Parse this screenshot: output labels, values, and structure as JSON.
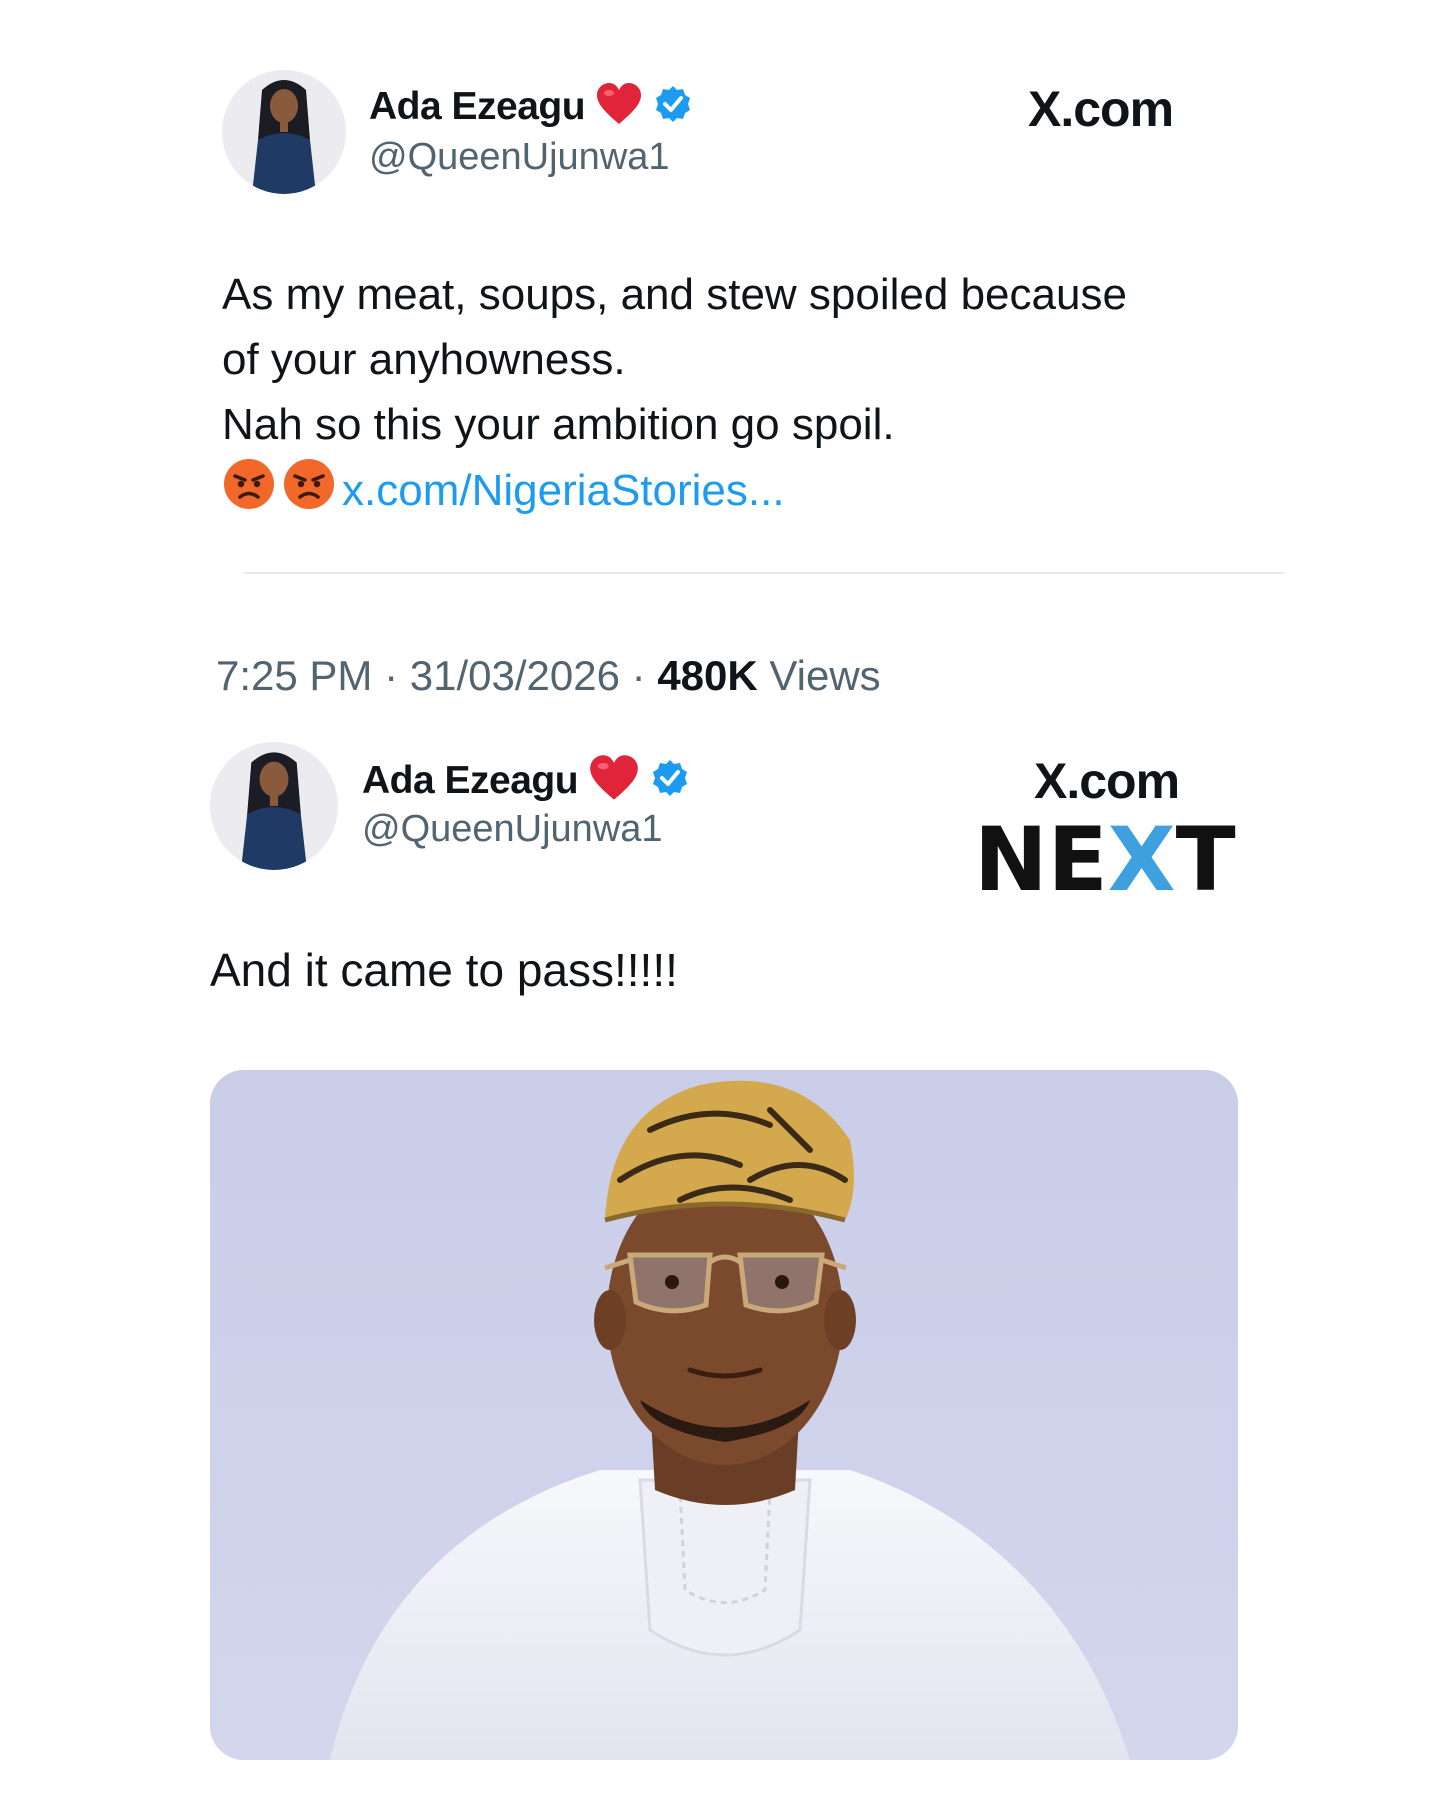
{
  "tweet1": {
    "display_name": "Ada Ezeagu",
    "handle": "@QueenUjunwa1",
    "source_label": "X.com",
    "lines": [
      "As my meat, soups, and stew spoiled because",
      "of your anyhowness.",
      "Nah so this your ambition go spoil."
    ],
    "link_text": "x.com/NigeriaStories...",
    "emojis": [
      "angry-face-emoji",
      "angry-face-emoji"
    ],
    "time": "7:25 PM",
    "separator": "·",
    "date": "31/03/2026",
    "views_count": "480K",
    "views_label": "Views"
  },
  "tweet2": {
    "display_name": "Ada Ezeagu",
    "handle": "@QueenUjunwa1",
    "source_label": "X.com",
    "brand_logo": "NEXT",
    "text": "And it came to pass!!!!!",
    "photo": "man-in-white-agbada-portrait"
  },
  "colors": {
    "link": "#1d9bf0",
    "verified": "#1d9bf0",
    "heart": "#e0243a",
    "muted": "#536471",
    "photo_bg": "#cdd1ea",
    "next_accent": "#3fa0e0"
  }
}
